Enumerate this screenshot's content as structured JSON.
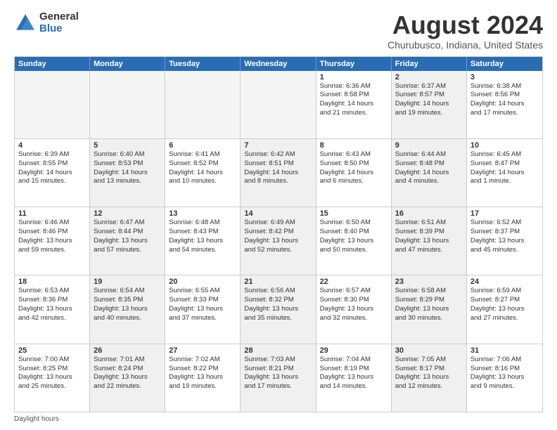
{
  "logo": {
    "general": "General",
    "blue": "Blue"
  },
  "title": "August 2024",
  "subtitle": "Churubusco, Indiana, United States",
  "days": [
    "Sunday",
    "Monday",
    "Tuesday",
    "Wednesday",
    "Thursday",
    "Friday",
    "Saturday"
  ],
  "footer": "Daylight hours",
  "weeks": [
    [
      {
        "day": "",
        "lines": [],
        "empty": true
      },
      {
        "day": "",
        "lines": [],
        "empty": true
      },
      {
        "day": "",
        "lines": [],
        "empty": true
      },
      {
        "day": "",
        "lines": [],
        "empty": true
      },
      {
        "day": "1",
        "lines": [
          "Sunrise: 6:36 AM",
          "Sunset: 8:58 PM",
          "Daylight: 14 hours",
          "and 21 minutes."
        ],
        "empty": false,
        "shaded": false
      },
      {
        "day": "2",
        "lines": [
          "Sunrise: 6:37 AM",
          "Sunset: 8:57 PM",
          "Daylight: 14 hours",
          "and 19 minutes."
        ],
        "empty": false,
        "shaded": true
      },
      {
        "day": "3",
        "lines": [
          "Sunrise: 6:38 AM",
          "Sunset: 8:56 PM",
          "Daylight: 14 hours",
          "and 17 minutes."
        ],
        "empty": false,
        "shaded": false
      }
    ],
    [
      {
        "day": "4",
        "lines": [
          "Sunrise: 6:39 AM",
          "Sunset: 8:55 PM",
          "Daylight: 14 hours",
          "and 15 minutes."
        ],
        "empty": false,
        "shaded": false
      },
      {
        "day": "5",
        "lines": [
          "Sunrise: 6:40 AM",
          "Sunset: 8:53 PM",
          "Daylight: 14 hours",
          "and 13 minutes."
        ],
        "empty": false,
        "shaded": true
      },
      {
        "day": "6",
        "lines": [
          "Sunrise: 6:41 AM",
          "Sunset: 8:52 PM",
          "Daylight: 14 hours",
          "and 10 minutes."
        ],
        "empty": false,
        "shaded": false
      },
      {
        "day": "7",
        "lines": [
          "Sunrise: 6:42 AM",
          "Sunset: 8:51 PM",
          "Daylight: 14 hours",
          "and 8 minutes."
        ],
        "empty": false,
        "shaded": true
      },
      {
        "day": "8",
        "lines": [
          "Sunrise: 6:43 AM",
          "Sunset: 8:50 PM",
          "Daylight: 14 hours",
          "and 6 minutes."
        ],
        "empty": false,
        "shaded": false
      },
      {
        "day": "9",
        "lines": [
          "Sunrise: 6:44 AM",
          "Sunset: 8:48 PM",
          "Daylight: 14 hours",
          "and 4 minutes."
        ],
        "empty": false,
        "shaded": true
      },
      {
        "day": "10",
        "lines": [
          "Sunrise: 6:45 AM",
          "Sunset: 8:47 PM",
          "Daylight: 14 hours",
          "and 1 minute."
        ],
        "empty": false,
        "shaded": false
      }
    ],
    [
      {
        "day": "11",
        "lines": [
          "Sunrise: 6:46 AM",
          "Sunset: 8:46 PM",
          "Daylight: 13 hours",
          "and 59 minutes."
        ],
        "empty": false,
        "shaded": false
      },
      {
        "day": "12",
        "lines": [
          "Sunrise: 6:47 AM",
          "Sunset: 8:44 PM",
          "Daylight: 13 hours",
          "and 57 minutes."
        ],
        "empty": false,
        "shaded": true
      },
      {
        "day": "13",
        "lines": [
          "Sunrise: 6:48 AM",
          "Sunset: 8:43 PM",
          "Daylight: 13 hours",
          "and 54 minutes."
        ],
        "empty": false,
        "shaded": false
      },
      {
        "day": "14",
        "lines": [
          "Sunrise: 6:49 AM",
          "Sunset: 8:42 PM",
          "Daylight: 13 hours",
          "and 52 minutes."
        ],
        "empty": false,
        "shaded": true
      },
      {
        "day": "15",
        "lines": [
          "Sunrise: 6:50 AM",
          "Sunset: 8:40 PM",
          "Daylight: 13 hours",
          "and 50 minutes."
        ],
        "empty": false,
        "shaded": false
      },
      {
        "day": "16",
        "lines": [
          "Sunrise: 6:51 AM",
          "Sunset: 8:39 PM",
          "Daylight: 13 hours",
          "and 47 minutes."
        ],
        "empty": false,
        "shaded": true
      },
      {
        "day": "17",
        "lines": [
          "Sunrise: 6:52 AM",
          "Sunset: 8:37 PM",
          "Daylight: 13 hours",
          "and 45 minutes."
        ],
        "empty": false,
        "shaded": false
      }
    ],
    [
      {
        "day": "18",
        "lines": [
          "Sunrise: 6:53 AM",
          "Sunset: 8:36 PM",
          "Daylight: 13 hours",
          "and 42 minutes."
        ],
        "empty": false,
        "shaded": false
      },
      {
        "day": "19",
        "lines": [
          "Sunrise: 6:54 AM",
          "Sunset: 8:35 PM",
          "Daylight: 13 hours",
          "and 40 minutes."
        ],
        "empty": false,
        "shaded": true
      },
      {
        "day": "20",
        "lines": [
          "Sunrise: 6:55 AM",
          "Sunset: 8:33 PM",
          "Daylight: 13 hours",
          "and 37 minutes."
        ],
        "empty": false,
        "shaded": false
      },
      {
        "day": "21",
        "lines": [
          "Sunrise: 6:56 AM",
          "Sunset: 8:32 PM",
          "Daylight: 13 hours",
          "and 35 minutes."
        ],
        "empty": false,
        "shaded": true
      },
      {
        "day": "22",
        "lines": [
          "Sunrise: 6:57 AM",
          "Sunset: 8:30 PM",
          "Daylight: 13 hours",
          "and 32 minutes."
        ],
        "empty": false,
        "shaded": false
      },
      {
        "day": "23",
        "lines": [
          "Sunrise: 6:58 AM",
          "Sunset: 8:29 PM",
          "Daylight: 13 hours",
          "and 30 minutes."
        ],
        "empty": false,
        "shaded": true
      },
      {
        "day": "24",
        "lines": [
          "Sunrise: 6:59 AM",
          "Sunset: 8:27 PM",
          "Daylight: 13 hours",
          "and 27 minutes."
        ],
        "empty": false,
        "shaded": false
      }
    ],
    [
      {
        "day": "25",
        "lines": [
          "Sunrise: 7:00 AM",
          "Sunset: 8:25 PM",
          "Daylight: 13 hours",
          "and 25 minutes."
        ],
        "empty": false,
        "shaded": false
      },
      {
        "day": "26",
        "lines": [
          "Sunrise: 7:01 AM",
          "Sunset: 8:24 PM",
          "Daylight: 13 hours",
          "and 22 minutes."
        ],
        "empty": false,
        "shaded": true
      },
      {
        "day": "27",
        "lines": [
          "Sunrise: 7:02 AM",
          "Sunset: 8:22 PM",
          "Daylight: 13 hours",
          "and 19 minutes."
        ],
        "empty": false,
        "shaded": false
      },
      {
        "day": "28",
        "lines": [
          "Sunrise: 7:03 AM",
          "Sunset: 8:21 PM",
          "Daylight: 13 hours",
          "and 17 minutes."
        ],
        "empty": false,
        "shaded": true
      },
      {
        "day": "29",
        "lines": [
          "Sunrise: 7:04 AM",
          "Sunset: 8:19 PM",
          "Daylight: 13 hours",
          "and 14 minutes."
        ],
        "empty": false,
        "shaded": false
      },
      {
        "day": "30",
        "lines": [
          "Sunrise: 7:05 AM",
          "Sunset: 8:17 PM",
          "Daylight: 13 hours",
          "and 12 minutes."
        ],
        "empty": false,
        "shaded": true
      },
      {
        "day": "31",
        "lines": [
          "Sunrise: 7:06 AM",
          "Sunset: 8:16 PM",
          "Daylight: 13 hours",
          "and 9 minutes."
        ],
        "empty": false,
        "shaded": false
      }
    ]
  ]
}
